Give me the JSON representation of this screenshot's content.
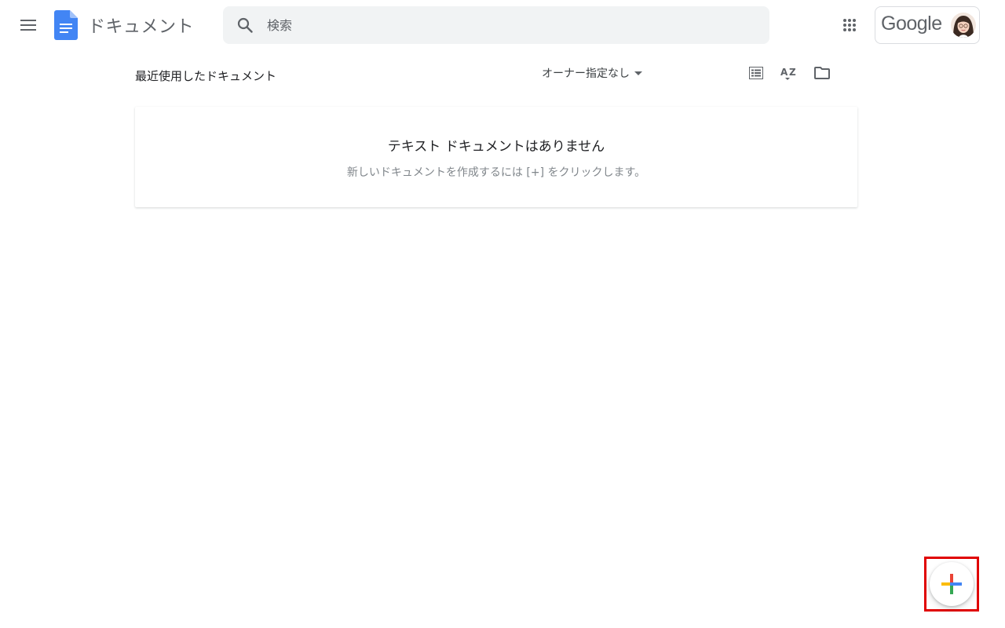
{
  "header": {
    "app_name": "ドキュメント",
    "search_placeholder": "検索",
    "account_brand": "Google"
  },
  "toolbar": {
    "section_title": "最近使用したドキュメント",
    "owner_filter": "オーナー指定なし"
  },
  "empty_state": {
    "title": "テキスト ドキュメントはありません",
    "subtitle": "新しいドキュメントを作成するには [+] をクリックします。"
  },
  "icons": {
    "menu": "menu-icon",
    "app_logo": "docs-logo-icon",
    "search": "search-icon",
    "apps": "apps-grid-icon",
    "list_view": "list-view-icon",
    "sort": "sort-az-icon",
    "folder": "folder-icon",
    "new": "plus-icon"
  },
  "colors": {
    "docs_blue": "#4285f4",
    "google_red": "#ea4335",
    "google_yellow": "#fbbc04",
    "google_green": "#34a853",
    "highlight": "#e00000"
  }
}
